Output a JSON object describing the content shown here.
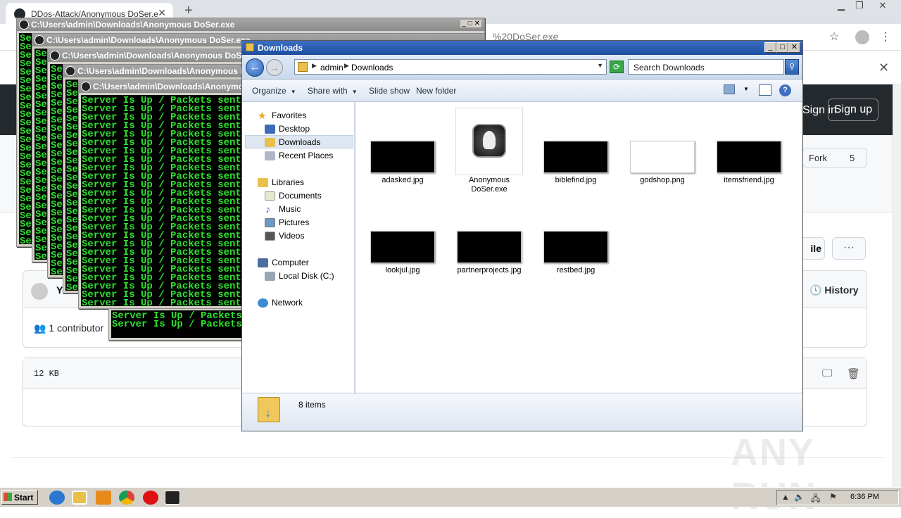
{
  "browser": {
    "tab_title": "DDos-Attack/Anonymous DoSer.exe",
    "tab_close": "✕",
    "new_tab": "+",
    "url_fragment": "%20DoSer.exe",
    "win_min": "▁",
    "win_max": "❐",
    "win_close": "✕"
  },
  "github": {
    "sign_in": "Sign in",
    "sign_up": "Sign up",
    "fork_label": "Fork",
    "fork_count": "5",
    "file_btn": "ile",
    "more": "···",
    "commit_initial": "Y",
    "history": "History",
    "contributors": "1 contributor",
    "file_size": "12 KB"
  },
  "consoles": {
    "title": "C:\\Users\\admin\\Downloads\\Anonymous DoSer.exe",
    "line_full": "Server Is Up / Packets sent:",
    "line_short": "Se",
    "line_mid": "Server Is Up / Packets"
  },
  "explorer": {
    "title": "Downloads",
    "breadcrumb": [
      "admin",
      "Downloads"
    ],
    "search_placeholder": "Search Downloads",
    "commands": {
      "organize": "Organize",
      "share_with": "Share with",
      "slide_show": "Slide show",
      "new_folder": "New folder"
    },
    "nav": {
      "favorites": "Favorites",
      "desktop": "Desktop",
      "downloads": "Downloads",
      "recent_places": "Recent Places",
      "libraries": "Libraries",
      "documents": "Documents",
      "music": "Music",
      "pictures": "Pictures",
      "videos": "Videos",
      "computer": "Computer",
      "local_disk": "Local Disk (C:)",
      "network": "Network"
    },
    "files": [
      {
        "name": "adasked.jpg"
      },
      {
        "name": "Anonymous DoSer.exe"
      },
      {
        "name": "biblefind.jpg"
      },
      {
        "name": "godshop.png"
      },
      {
        "name": "itemsfriend.jpg"
      },
      {
        "name": "lookjul.jpg"
      },
      {
        "name": "partnerprojects.jpg"
      },
      {
        "name": "restbed.jpg"
      }
    ],
    "status": "8 items"
  },
  "taskbar": {
    "start": "Start",
    "clock": "6:36 PM"
  },
  "watermark": "ANY RUN"
}
